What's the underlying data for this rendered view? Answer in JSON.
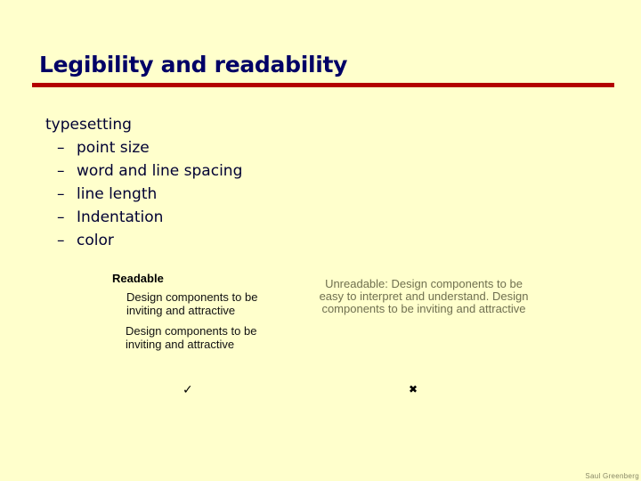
{
  "slide": {
    "title": "Legibility and readability",
    "colors": {
      "background": "#FFFFCC",
      "title": "#000066",
      "rule": "#B30000",
      "unreadable_text": "#707050"
    }
  },
  "outline": {
    "heading": "typesetting",
    "bullet_glyph": "–",
    "items": [
      "point size",
      "word and line spacing",
      "line length",
      "Indentation",
      "color"
    ]
  },
  "examples": {
    "readable_label": "Readable",
    "readable_samples": [
      "Design components to be inviting and attractive",
      "Design components to be inviting and attractive"
    ],
    "unreadable_sample": "Unreadable: Design components to be easy to interpret and understand. Design components to be inviting and attractive",
    "check_icon": "✓",
    "cross_icon": "✖"
  },
  "footer": {
    "author": "Saul Greenberg"
  }
}
